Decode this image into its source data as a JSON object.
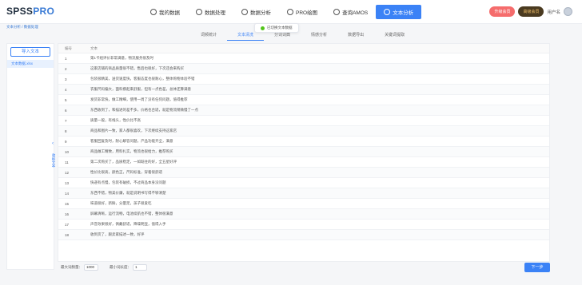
{
  "app": {
    "logo_main": "SPSS",
    "logo_accent": "PRO"
  },
  "nav": [
    {
      "label": "我的数据",
      "icon": "folder-icon",
      "active": false
    },
    {
      "label": "数据处理",
      "icon": "settings-icon",
      "active": false
    },
    {
      "label": "数据分析",
      "icon": "clock-icon",
      "active": false
    },
    {
      "label": "PRO绘图",
      "icon": "chart-icon",
      "active": false
    },
    {
      "label": "查询AMOS",
      "icon": "document-icon",
      "active": false
    },
    {
      "label": "文本分析",
      "icon": "text-icon",
      "active": true
    }
  ],
  "top_right": {
    "upgrade": "升级会员",
    "vip": "高级会员",
    "user": "用户名"
  },
  "breadcrumb": "文本分析 / 数据处理",
  "toast": "已切换文本数据",
  "tabs": [
    {
      "label": "词频统计",
      "active": false
    },
    {
      "label": "文本清洗",
      "active": true
    },
    {
      "label": "分词词典",
      "active": false
    },
    {
      "label": "情感分析",
      "active": false
    },
    {
      "label": "数据导出",
      "active": false
    },
    {
      "label": "关键词提取",
      "active": false
    }
  ],
  "sidebar": {
    "upload": "导入文本",
    "files": [
      "文本数据.xlsx"
    ],
    "collapse": "收起文本"
  },
  "table": {
    "headers": [
      "编号",
      "文本"
    ],
    "rows": [
      {
        "id": "1",
        "text": "第1卡组评价非常满意，物流服务很及时"
      },
      {
        "id": "2",
        "text": "这家店铺的商品质量很不错，售后也很好，下次还会来购买"
      },
      {
        "id": "3",
        "text": "包装很精美，送货速度快，客服态度也很耐心，整体购物体验不错"
      },
      {
        "id": "4",
        "text": "衣服尺码偏大，面料摸起来舒服，但有一点色差，总体还算满意"
      },
      {
        "id": "5",
        "text": "发货非常快，做工精细，使用一周了没有任何问题，值得推荐"
      },
      {
        "id": "6",
        "text": "东西收到了，和描述的差不多，价格也合适，就是物流稍微慢了一点"
      },
      {
        "id": "7",
        "text": "质量一般，有线头，性价比不高"
      },
      {
        "id": "8",
        "text": "商品和图片一致，家人都很喜欢，下次继续支持这家店"
      },
      {
        "id": "9",
        "text": "客服回复及时，耐心解答问题，产品功能齐全，满意"
      },
      {
        "id": "10",
        "text": "商品做工精致，用料扎实，物流也很给力，推荐购买"
      },
      {
        "id": "11",
        "text": "第二次购买了，品质稳定，一如既往的好，全五星好评"
      },
      {
        "id": "12",
        "text": "性价比很高，颜色正，尺码标准，穿着很舒适"
      },
      {
        "id": "13",
        "text": "快递有点慢，包装有破损，不过商品本身没问题"
      },
      {
        "id": "14",
        "text": "东西不错，物美价廉，就是说明书写得不够清楚"
      },
      {
        "id": "15",
        "text": "味道很好，新鲜，分量足，孩子很爱吃"
      },
      {
        "id": "16",
        "text": "屏幕清晰，运行流畅，电池续航也不错，整体很满意"
      },
      {
        "id": "17",
        "text": "声音效果很好，佩戴舒适，降噪明显，值得入手"
      },
      {
        "id": "18",
        "text": "收到货了，跟卖家描述一致，好评"
      }
    ]
  },
  "bottom": {
    "min_freq_label": "最大词频量：",
    "min_freq_value": "1000",
    "min_len_label": "最小词长度：",
    "min_len_value": "1",
    "next": "下一步"
  }
}
